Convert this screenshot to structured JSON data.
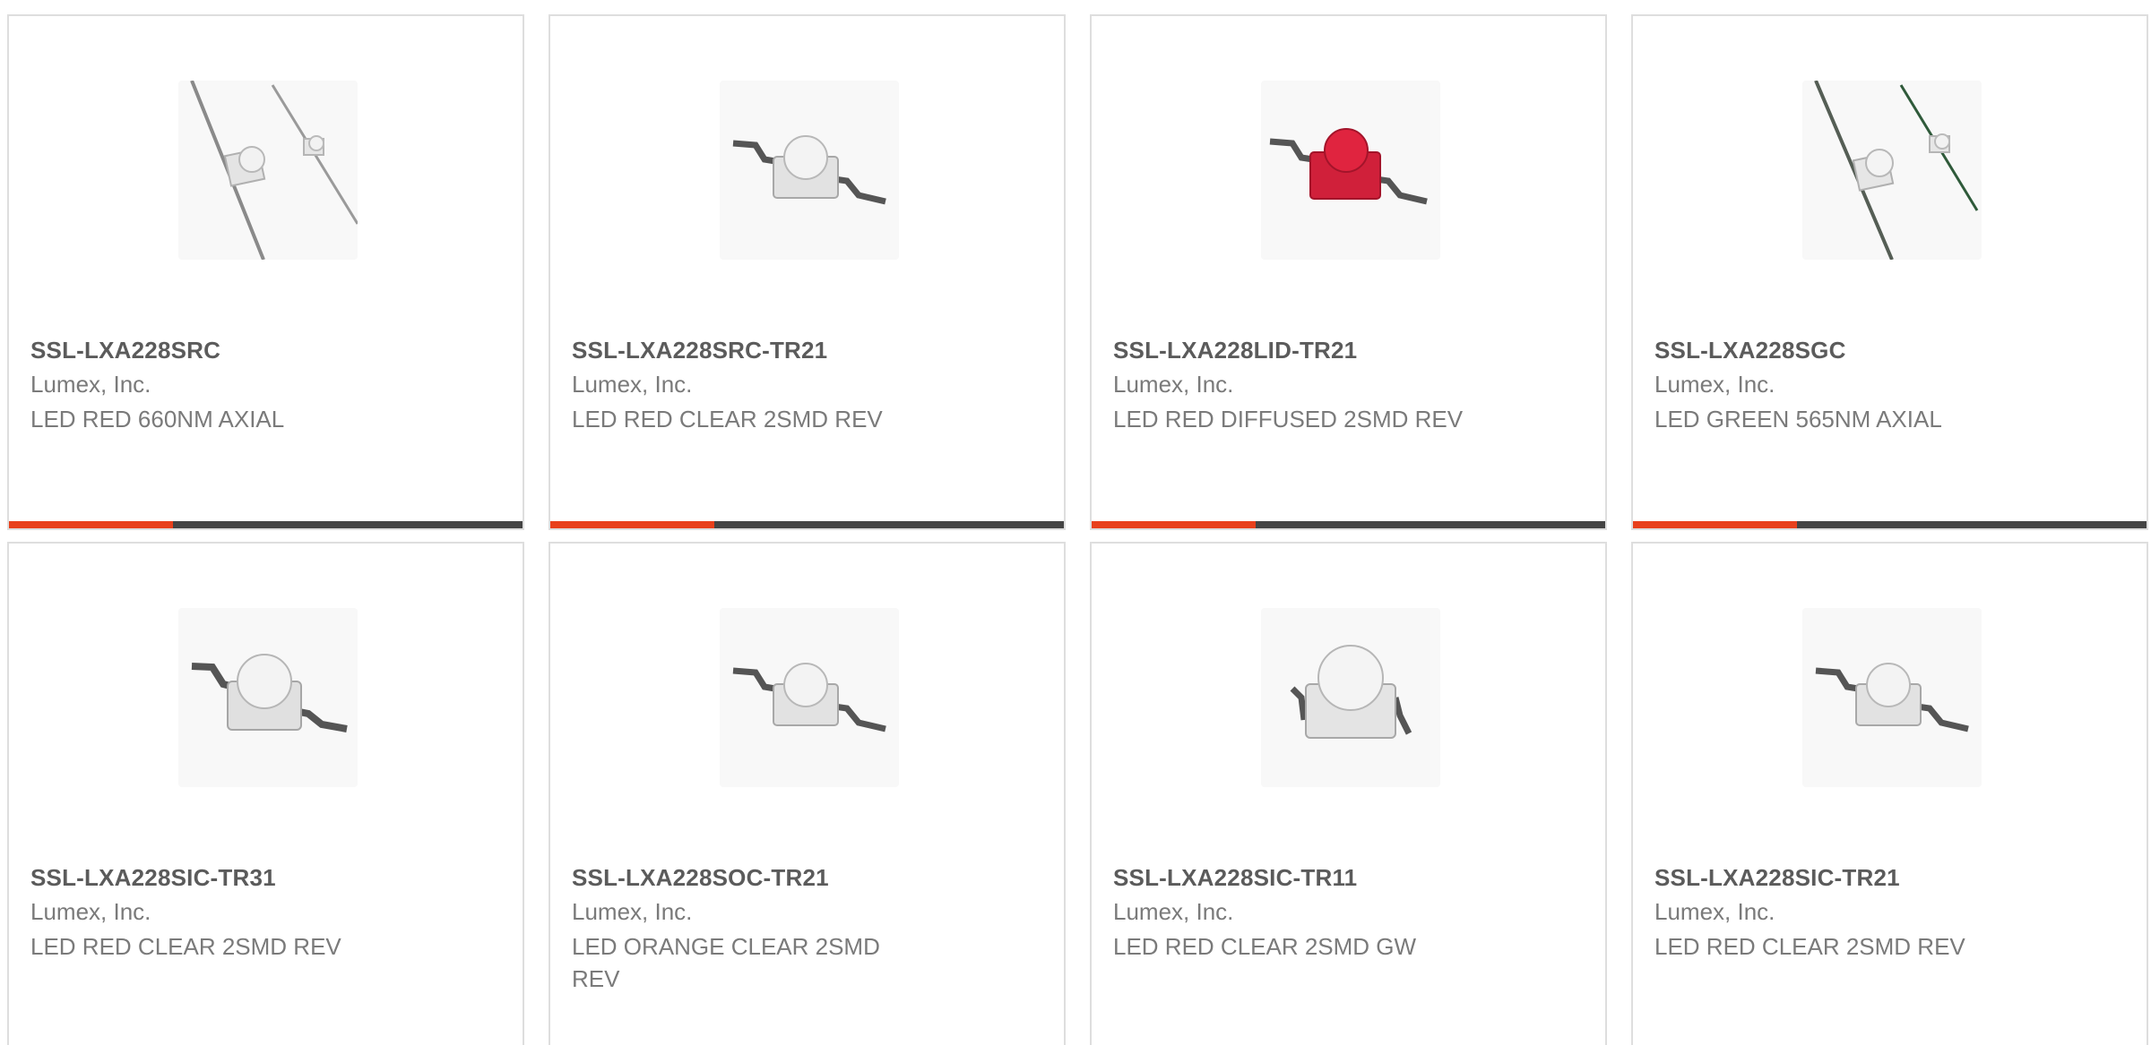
{
  "colors": {
    "accent": "#e8401c",
    "bar_track": "#444444",
    "border": "#dedede",
    "title_text": "#5b5b5b",
    "body_text": "#7a7a7a"
  },
  "products": [
    {
      "part_number": "SSL-LXA228SRC",
      "manufacturer": "Lumex, Inc.",
      "description": "LED RED 660NM AXIAL",
      "image": "led-axial-clear-icon"
    },
    {
      "part_number": "SSL-LXA228SRC-TR21",
      "manufacturer": "Lumex, Inc.",
      "description": "LED RED CLEAR 2SMD REV",
      "image": "led-smd-clear-icon"
    },
    {
      "part_number": "SSL-LXA228LID-TR21",
      "manufacturer": "Lumex, Inc.",
      "description": "LED RED DIFFUSED 2SMD REV",
      "image": "led-smd-red-diffused-icon"
    },
    {
      "part_number": "SSL-LXA228SGC",
      "manufacturer": "Lumex, Inc.",
      "description": "LED GREEN 565NM AXIAL",
      "image": "led-axial-clear-icon"
    },
    {
      "part_number": "SSL-LXA228SIC-TR31",
      "manufacturer": "Lumex, Inc.",
      "description": "LED RED CLEAR 2SMD REV",
      "image": "led-smd-clear-icon"
    },
    {
      "part_number": "SSL-LXA228SOC-TR21",
      "manufacturer": "Lumex, Inc.",
      "description": "LED ORANGE CLEAR 2SMD REV",
      "image": "led-smd-clear-icon"
    },
    {
      "part_number": "SSL-LXA228SIC-TR11",
      "manufacturer": "Lumex, Inc.",
      "description": "LED RED CLEAR 2SMD GW",
      "image": "led-smd-clear-icon"
    },
    {
      "part_number": "SSL-LXA228SIC-TR21",
      "manufacturer": "Lumex, Inc.",
      "description": "LED RED CLEAR 2SMD REV",
      "image": "led-smd-clear-icon"
    }
  ]
}
